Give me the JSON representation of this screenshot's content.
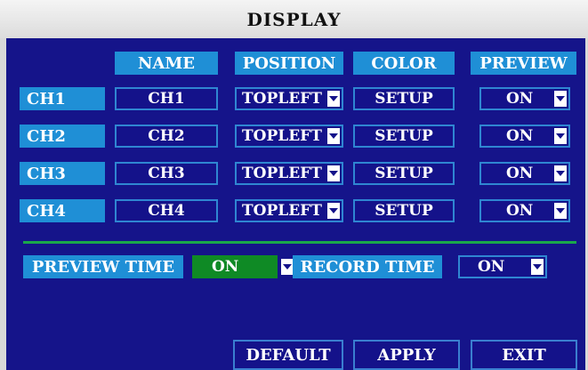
{
  "title": "DISPLAY",
  "headers": {
    "name": "NAME",
    "position": "POSITION",
    "color": "COLOR",
    "preview": "PREVIEW"
  },
  "channels": [
    {
      "label": "CH1",
      "name": "CH1",
      "position": "TOPLEFT",
      "color": "SETUP",
      "preview": "ON"
    },
    {
      "label": "CH2",
      "name": "CH2",
      "position": "TOPLEFT",
      "color": "SETUP",
      "preview": "ON"
    },
    {
      "label": "CH3",
      "name": "CH3",
      "position": "TOPLEFT",
      "color": "SETUP",
      "preview": "ON"
    },
    {
      "label": "CH4",
      "name": "CH4",
      "position": "TOPLEFT",
      "color": "SETUP",
      "preview": "ON"
    }
  ],
  "preview_time": {
    "label": "PREVIEW TIME",
    "value": "ON"
  },
  "record_time": {
    "label": "RECORD TIME",
    "value": "ON"
  },
  "buttons": {
    "default": "DEFAULT",
    "apply": "APPLY",
    "exit": "EXIT"
  },
  "icons": {
    "dropdown": "chevron-down-icon"
  },
  "colors": {
    "panel": "#15148a",
    "header": "#1f8fd6",
    "accent_green": "#0f8a25",
    "border": "#2f86d2"
  }
}
